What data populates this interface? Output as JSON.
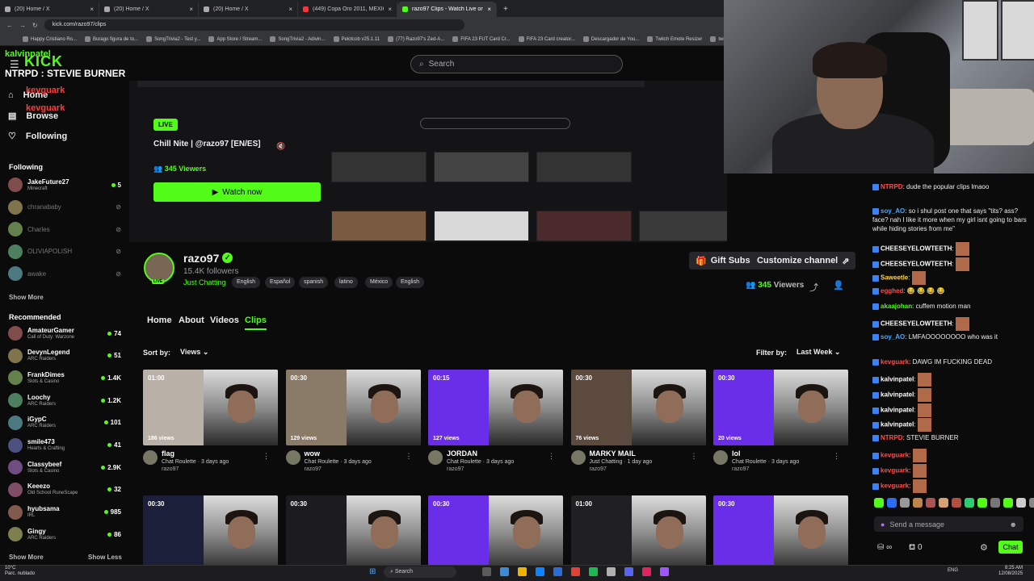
{
  "browser": {
    "tabs": [
      {
        "label": "(20) Home / X",
        "active": false
      },
      {
        "label": "(20) Home / X",
        "active": false
      },
      {
        "label": "(20) Home / X",
        "active": false
      },
      {
        "label": "(449) Copa Oro 2011, MÉXICO",
        "active": false
      },
      {
        "label": "razo97 Clips - Watch Live on Ki",
        "active": true
      }
    ],
    "new_tab": "+",
    "url": "kick.com/razo97/clips",
    "bookmarks": [
      "Happy Cristiano Ro...",
      "Burago figura de to...",
      "SongTrivia2 - Test y...",
      "App Store / Stream...",
      "SongTrivia2 - Adivin...",
      "Pelotcob v25.1.11",
      "(77) Razo97's Zed-A...",
      "FIFA 23 FUT Card Cr...",
      "FIFA 23 Card creator...",
      "Descargador de You...",
      "Twitch Emote Resizer",
      "twitch em"
    ]
  },
  "overlay": {
    "user1": "kalvinpatel",
    "line1": "NTRPD : STEVIE BURNER",
    "user2": "kevguark",
    "user3": "kevguark"
  },
  "header": {
    "logo": "KICK",
    "search_placeholder": "Search"
  },
  "sidebar": {
    "nav": [
      {
        "label": "Home",
        "icon": "home-icon"
      },
      {
        "label": "Browse",
        "icon": "browse-icon"
      },
      {
        "label": "Following",
        "icon": "heart-icon"
      }
    ],
    "following_title": "Following",
    "following": [
      {
        "name": "JakeFuture27",
        "category": "Minecraft",
        "viewers": "5",
        "online": true
      },
      {
        "name": "chranababy",
        "category": "",
        "viewers": "",
        "online": false
      },
      {
        "name": "Charles",
        "category": "",
        "viewers": "",
        "online": false
      },
      {
        "name": "OLIVIAPOLISH",
        "category": "",
        "viewers": "",
        "online": false
      },
      {
        "name": "awake",
        "category": "",
        "viewers": "",
        "online": false
      }
    ],
    "show_more": "Show More",
    "recommended_title": "Recommended",
    "recommended": [
      {
        "name": "AmateurGamer",
        "category": "Call of Duty: Warzone",
        "viewers": "74"
      },
      {
        "name": "DevynLegend",
        "category": "ARC Raiders",
        "viewers": "51"
      },
      {
        "name": "FrankDimes",
        "category": "Slots & Casino",
        "viewers": "1.4K"
      },
      {
        "name": "Loochy",
        "category": "ARC Raiders",
        "viewers": "1.2K"
      },
      {
        "name": "iGypC",
        "category": "ARC Raiders",
        "viewers": "101"
      },
      {
        "name": "smile473",
        "category": "Hearts & Crafting",
        "viewers": "41"
      },
      {
        "name": "Classybeef",
        "category": "Slots & Casino",
        "viewers": "2.9K"
      },
      {
        "name": "Keeezo",
        "category": "Old School RuneScape",
        "viewers": "32"
      },
      {
        "name": "hyubsama",
        "category": "IRL",
        "viewers": "985"
      },
      {
        "name": "Gingy",
        "category": "ARC Raiders",
        "viewers": "86"
      }
    ],
    "show_more2": "Show More",
    "show_less": "Show Less"
  },
  "preview": {
    "live": "LIVE",
    "title": "Chill Nite | @razo97 [EN/ES]",
    "viewers": "345 Viewers",
    "watch": "Watch now"
  },
  "profile": {
    "name": "razo97",
    "followers": "15.4K followers",
    "category": "Just Chatting",
    "avatar_live": "LIVE",
    "tags": [
      "English",
      "Español",
      "spanish",
      "latino",
      "México",
      "English"
    ],
    "gift_subs": "Gift Subs",
    "customize": "Customize channel",
    "viewers_count": "345",
    "viewers_label": "Viewers"
  },
  "channel_tabs": [
    "Home",
    "About",
    "Videos",
    "Clips"
  ],
  "sort": {
    "label": "Sort by:",
    "value": "Views"
  },
  "filter": {
    "label": "Filter by:",
    "value": "Last Week"
  },
  "clips": [
    {
      "duration": "01:00",
      "views": "186 views",
      "title": "flag",
      "sub": "Chat Roulette · 3 days ago",
      "owner": "razo97",
      "bg": "#b9b1a8"
    },
    {
      "duration": "00:30",
      "views": "129 views",
      "title": "wow",
      "sub": "Chat Roulette · 3 days ago",
      "owner": "razo97",
      "bg": "#8a7a68"
    },
    {
      "duration": "00:15",
      "views": "127 views",
      "title": "JORDAN",
      "sub": "Chat Roulette · 3 days ago",
      "owner": "razo97",
      "bg": "#6b2ee8"
    },
    {
      "duration": "00:30",
      "views": "76 views",
      "title": "MARKY MAIL",
      "sub": "Just Chatting · 1 day ago",
      "owner": "razo97",
      "bg": "#5c4a3e"
    },
    {
      "duration": "00:30",
      "views": "20 views",
      "title": "lol",
      "sub": "Chat Roulette · 3 days ago",
      "owner": "razo97",
      "bg": "#6b2ee8"
    },
    {
      "duration": "00:30",
      "views": "",
      "title": "",
      "sub": "",
      "owner": "",
      "bg": "#1b1f3a"
    },
    {
      "duration": "00:30",
      "views": "",
      "title": "",
      "sub": "",
      "owner": "",
      "bg": "#1c1c20"
    },
    {
      "duration": "00:30",
      "views": "",
      "title": "",
      "sub": "",
      "owner": "",
      "bg": "#6b2ee8"
    },
    {
      "duration": "01:00",
      "views": "",
      "title": "",
      "sub": "",
      "owner": "",
      "bg": "#202022"
    },
    {
      "duration": "00:30",
      "views": "",
      "title": "",
      "sub": "",
      "owner": "",
      "bg": "#6b2ee8"
    }
  ],
  "chat": {
    "messages": [
      {
        "user": "NTRPD",
        "color": "#ff4d4d",
        "text": "dude the popular clips lmaoo"
      },
      {
        "user": "soy_AO",
        "color": "#4da6ff",
        "text": "so i shul post one that says \"tits? ass? face? nah I like it more when my girl isnt going to bars while hiding stories from me\""
      },
      {
        "user": "CHEESEYELOWTEETH",
        "color": "#ffffff",
        "text": ""
      },
      {
        "user": "CHEESEYELOWTEETH",
        "color": "#ffffff",
        "text": ""
      },
      {
        "user": "Saweetle",
        "color": "#ffd84d",
        "text": ""
      },
      {
        "user": "egghed",
        "color": "#ff4d4d",
        "text": "😂 😂 😂 😂"
      },
      {
        "user": "akaajohan",
        "color": "#53fc18",
        "text": "cuffem motion man"
      },
      {
        "user": "CHEESEYELOWTEETH",
        "color": "#ffffff",
        "text": ""
      },
      {
        "user": "soy_AO",
        "color": "#4da6ff",
        "text": "LMFAOOOOOOOO who was it"
      },
      {
        "user": "kevguark",
        "color": "#ff4d4d",
        "text": "DAWG IM FUCKING DEAD"
      },
      {
        "user": "kalvinpatel",
        "color": "#ffffff",
        "text": ""
      },
      {
        "user": "kalvinpatel",
        "color": "#ffffff",
        "text": ""
      },
      {
        "user": "kalvinpatel",
        "color": "#ffffff",
        "text": ""
      },
      {
        "user": "kalvinpatel",
        "color": "#ffffff",
        "text": ""
      },
      {
        "user": "NTRPD",
        "color": "#ff4d4d",
        "text": "STEVIE BURNER"
      },
      {
        "user": "kevguark",
        "color": "#ff4d4d",
        "text": ""
      },
      {
        "user": "kevguark",
        "color": "#ff4d4d",
        "text": ""
      },
      {
        "user": "kevguark",
        "color": "#ff4d4d",
        "text": ""
      }
    ],
    "placeholder": "Send a message",
    "points": "0",
    "send": "Chat"
  },
  "taskbar": {
    "weather_temp": "10°C",
    "weather_desc": "Parc. nublado",
    "search": "Search",
    "lang": "ENG",
    "time": "8:25 AM",
    "date": "12/08/2025"
  },
  "colors": {
    "accent": "#53fc18",
    "background": "#0b0b0c",
    "chip": "#26262b"
  }
}
